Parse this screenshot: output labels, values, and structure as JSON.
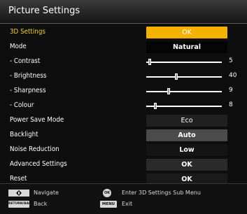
{
  "title": "Picture Settings",
  "rows": [
    {
      "label": "3D Settings",
      "value": "OK"
    },
    {
      "label": "Mode",
      "value": "Natural"
    },
    {
      "label": "- Contrast",
      "value": "5",
      "level": 0.05
    },
    {
      "label": "- Brightness",
      "value": "40",
      "level": 0.4
    },
    {
      "label": "- Sharpness",
      "value": "9",
      "level": 0.3
    },
    {
      "label": "- Colour",
      "value": "8",
      "level": 0.12
    },
    {
      "label": "Power Save Mode",
      "value": "Eco"
    },
    {
      "label": "Backlight",
      "value": "Auto"
    },
    {
      "label": "Noise Reduction",
      "value": "Low"
    },
    {
      "label": "Advanced Settings",
      "value": "OK"
    },
    {
      "label": "Reset",
      "value": "OK"
    }
  ],
  "footer": {
    "navigate_label": "Navigate",
    "back_key": "RETURN/BACK",
    "back_label": "Back",
    "ok_key": "OK",
    "ok_label": "Enter 3D Settings Sub Menu",
    "menu_key": "MENU",
    "exit_label": "Exit"
  },
  "colors": {
    "accent": "#f5b100",
    "active_label": "#f0d03a"
  }
}
